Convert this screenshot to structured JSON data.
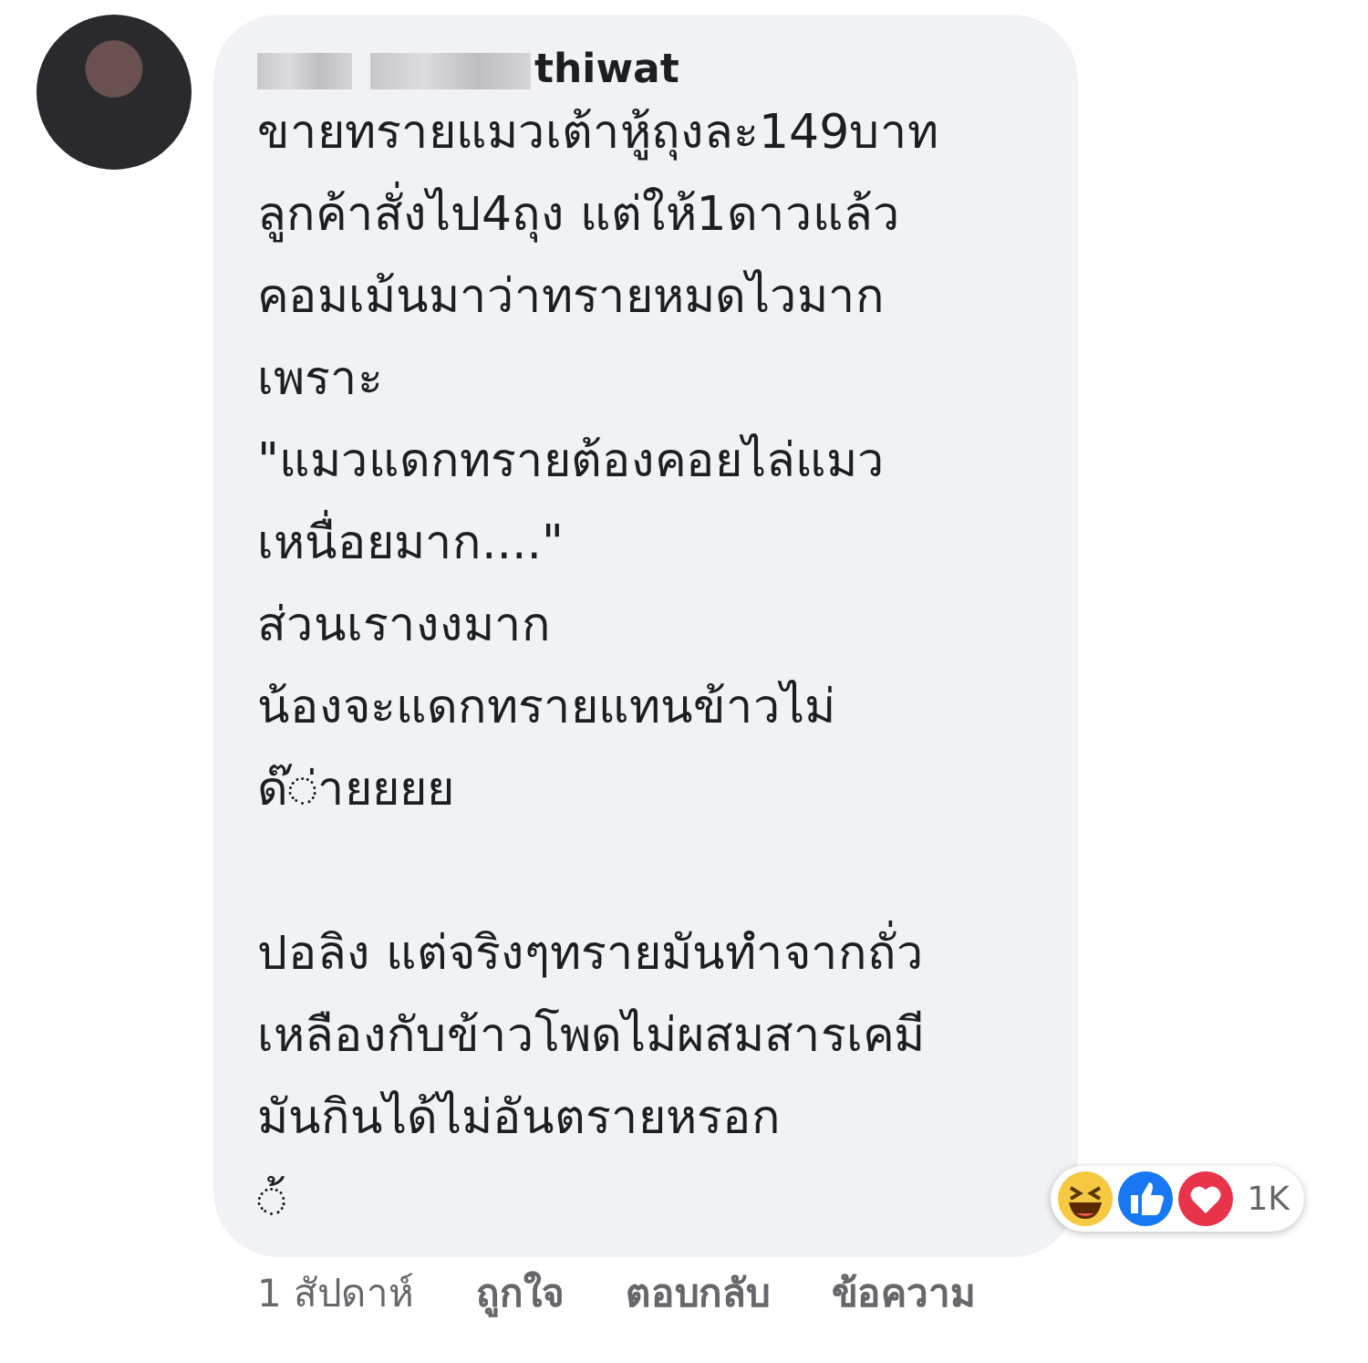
{
  "comment": {
    "author": "thiwat",
    "author_redacted": true,
    "paragraphs": [
      [
        "ขายทรายแมวเต้าหู้ถุงละ149บาท",
        "ลูกค้าสั่งไป4ถุง แต่ให้1ดาวแล้ว",
        "คอมเม้นมาว่าทรายหมดไวมาก",
        "เพราะ",
        "\"แมวแดกทรายต้องคอยไล่แมว",
        "เหนื่อยมาก....\"",
        "ส่วนเรางงมาก",
        "น้องจะแดกทรายแทนข้าวไม่",
        "ด๊◌่ายยยย"
      ],
      [
        "ปอลิง แต่จริงๆทรายมันทำจากถั่ว",
        "เหลืองกับข้าวโพดไม่ผสมสารเคมี",
        "มันกินได้ไม่อันตรายหรอก",
        "◌้"
      ]
    ],
    "reactions": {
      "count": "1K"
    },
    "actions": [
      {
        "kind": "time",
        "label": "1 สัปดาห์"
      },
      {
        "kind": "link",
        "label": "ถูกใจ"
      },
      {
        "kind": "link",
        "label": "ตอบกลับ"
      },
      {
        "kind": "link",
        "label": "ข้อความ"
      }
    ]
  }
}
